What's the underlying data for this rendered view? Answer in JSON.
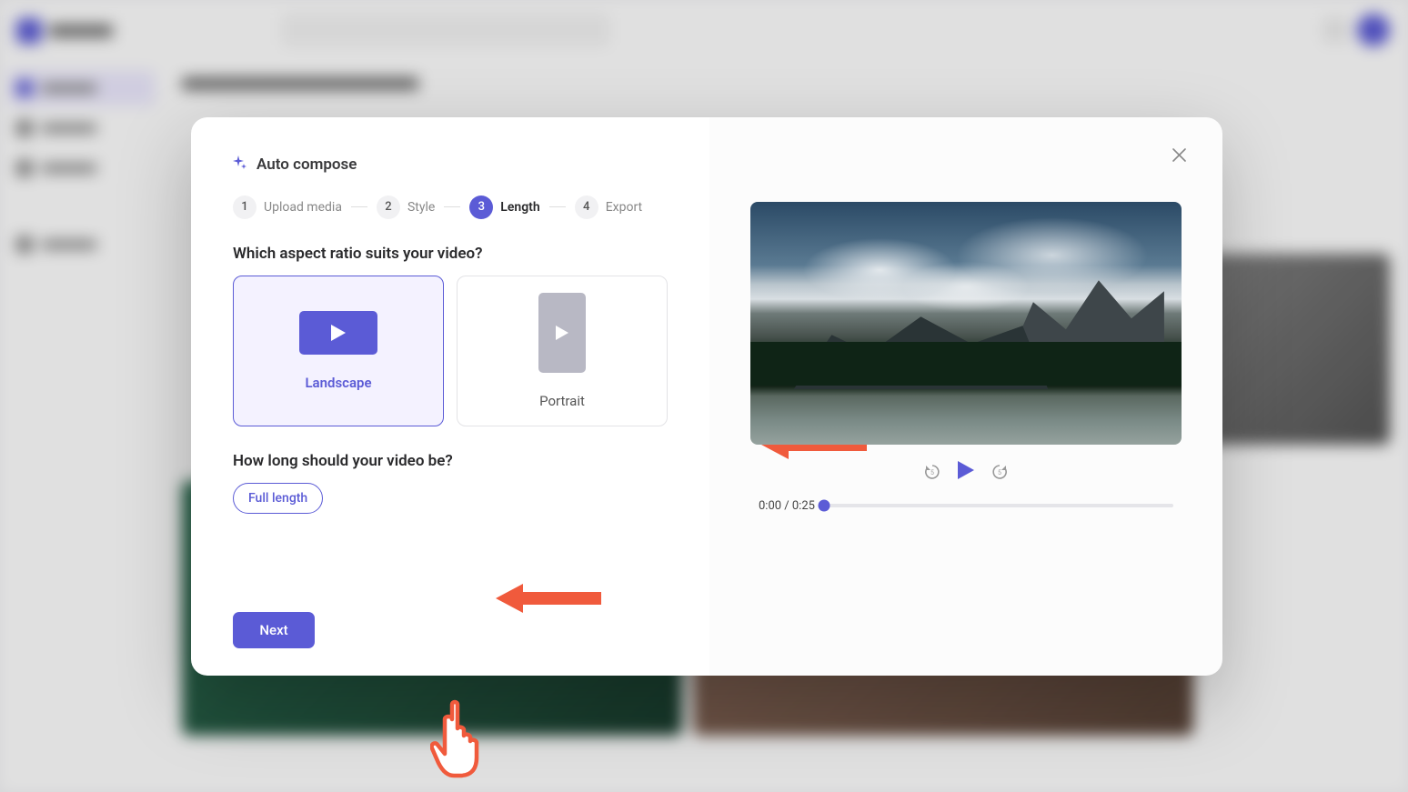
{
  "modal": {
    "title": "Auto compose",
    "steps": [
      {
        "num": "1",
        "label": "Upload media"
      },
      {
        "num": "2",
        "label": "Style"
      },
      {
        "num": "3",
        "label": "Length"
      },
      {
        "num": "4",
        "label": "Export"
      }
    ],
    "aspect_question": "Which aspect ratio suits your video?",
    "aspect_options": {
      "landscape": "Landscape",
      "portrait": "Portrait"
    },
    "length_question": "How long should your video be?",
    "length_options": {
      "full": "Full length"
    },
    "next_label": "Next"
  },
  "preview": {
    "time": "0:00 / 0:25",
    "rewind_seconds": "5",
    "forward_seconds": "5"
  }
}
